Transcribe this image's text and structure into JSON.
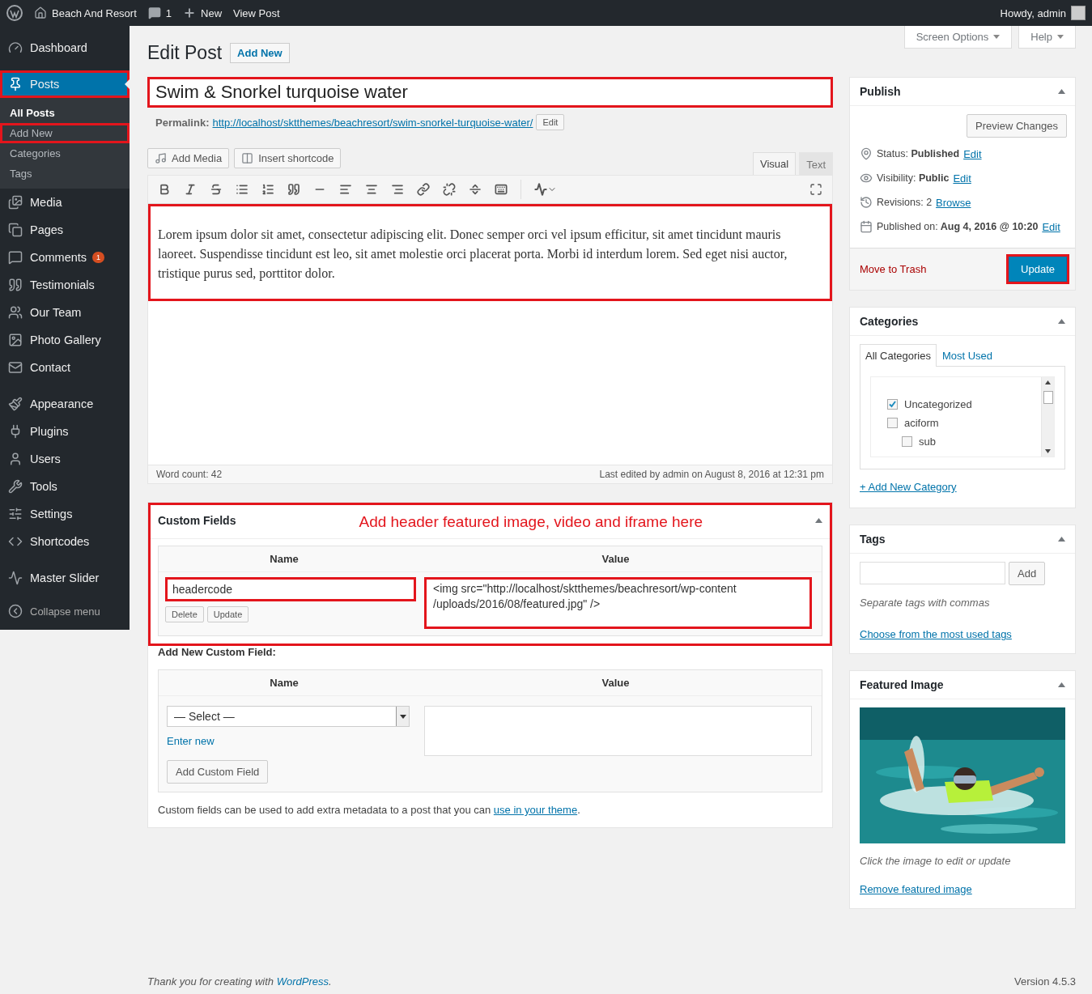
{
  "admin_bar": {
    "site": "Beach And Resort",
    "comments": "1",
    "new": "New",
    "view": "View Post",
    "greeting": "Howdy, admin"
  },
  "sidebar": {
    "groups": [
      [
        {
          "label": "Dashboard",
          "selected": false,
          "highlighted": false
        }
      ],
      [
        {
          "label": "Posts",
          "selected": true,
          "highlighted": true,
          "submenu": [
            {
              "label": "All Posts",
              "selected": true,
              "highlighted": false
            },
            {
              "label": "Add New",
              "selected": false,
              "highlighted": true
            },
            {
              "label": "Categories",
              "selected": false,
              "highlighted": false
            },
            {
              "label": "Tags",
              "selected": false,
              "highlighted": false
            }
          ]
        },
        {
          "label": "Media",
          "selected": false,
          "highlighted": false
        },
        {
          "label": "Pages",
          "selected": false,
          "highlighted": false
        },
        {
          "label": "Comments",
          "selected": false,
          "highlighted": false,
          "badge": "1"
        },
        {
          "label": "Testimonials",
          "selected": false,
          "highlighted": false
        },
        {
          "label": "Our Team",
          "selected": false,
          "highlighted": false
        },
        {
          "label": "Photo Gallery",
          "selected": false,
          "highlighted": false
        },
        {
          "label": "Contact",
          "selected": false,
          "highlighted": false
        }
      ],
      [
        {
          "label": "Appearance",
          "selected": false,
          "highlighted": false
        },
        {
          "label": "Plugins",
          "selected": false,
          "highlighted": false
        },
        {
          "label": "Users",
          "selected": false,
          "highlighted": false
        },
        {
          "label": "Tools",
          "selected": false,
          "highlighted": false
        },
        {
          "label": "Settings",
          "selected": false,
          "highlighted": false
        },
        {
          "label": "Shortcodes",
          "selected": false,
          "highlighted": false
        }
      ],
      [
        {
          "label": "Master Slider",
          "selected": false,
          "highlighted": false
        }
      ]
    ],
    "collapse": "Collapse menu"
  },
  "header": {
    "title": "Edit Post",
    "add_new": "Add New",
    "screen_tabs": [
      "Screen Options",
      "Help"
    ]
  },
  "post": {
    "title": {
      "value": "Swim & Snorkel turquoise water",
      "highlighted": true
    },
    "permalink": {
      "label": "Permalink:",
      "url": "http://localhost/sktthemes/beachresort/swim-snorkel-turquoise-water/",
      "edit": "Edit"
    },
    "media_buttons": [
      "Add Media",
      "Insert shortcode"
    ],
    "editor_tabs": [
      {
        "label": "Visual",
        "selected": true
      },
      {
        "label": "Text",
        "selected": false
      }
    ],
    "content": {
      "text": "Lorem ipsum dolor sit amet, consectetur adipiscing elit. Donec semper orci vel ipsum efficitur, sit amet tincidunt mauris laoreet. Suspendisse tincidunt est leo, sit amet molestie orci placerat porta. Morbi id interdum lorem. Sed eget nisi auctor, tristique purus sed, porttitor dolor.",
      "highlighted": true
    },
    "word_count": "Word count: 42",
    "last_edited": "Last edited by admin on August 8, 2016 at 12:31 pm"
  },
  "custom_fields": {
    "title": "Custom Fields",
    "annotation": "Add header featured image, video and iframe here",
    "highlighted": true,
    "columns": [
      "Name",
      "Value"
    ],
    "rows": [
      {
        "name": "headercode",
        "value": "<img src=\"http://localhost/sktthemes/beachresort/wp-content\n/uploads/2016/08/featured.jpg\" />",
        "name_highlighted": true,
        "value_highlighted": true,
        "buttons": [
          "Delete",
          "Update"
        ]
      }
    ],
    "add_new": {
      "heading": "Add New Custom Field:",
      "columns": [
        "Name",
        "Value"
      ],
      "select": "— Select —",
      "enter_new": "Enter new",
      "button": "Add Custom Field"
    },
    "note": "Custom fields can be used to add extra metadata to a post that you can ",
    "note_link": "use in your theme",
    "note_end": "."
  },
  "publish": {
    "title": "Publish",
    "preview": "Preview Changes",
    "rows": [
      {
        "label": "Status:",
        "value": "Published",
        "link": "Edit"
      },
      {
        "label": "Visibility:",
        "value": "Public",
        "link": "Edit"
      },
      {
        "label": "Revisions: 2",
        "link": "Browse"
      },
      {
        "label": "Published on:",
        "value": "Aug 4, 2016 @ 10:20",
        "link": "Edit"
      }
    ],
    "trash": "Move to Trash",
    "update": {
      "label": "Update",
      "highlighted": true
    }
  },
  "categories": {
    "title": "Categories",
    "tabs": [
      {
        "label": "All Categories",
        "selected": true
      },
      {
        "label": "Most Used",
        "selected": false
      }
    ],
    "items": [
      {
        "label": "Uncategorized",
        "checked": true
      },
      {
        "label": "aciform",
        "checked": false,
        "children": [
          {
            "label": "sub",
            "checked": false
          }
        ]
      }
    ],
    "add_link": "+ Add New Category"
  },
  "tags": {
    "title": "Tags",
    "button": "Add",
    "hint": "Separate tags with commas",
    "link": "Choose from the most used tags"
  },
  "featured": {
    "title": "Featured Image",
    "hint": "Click the image to edit or update",
    "link": "Remove featured image"
  },
  "footer": {
    "credit_prefix": "Thank you for creating with ",
    "credit_link": "WordPress",
    "credit_suffix": ".",
    "version": "Version 4.5.3"
  }
}
